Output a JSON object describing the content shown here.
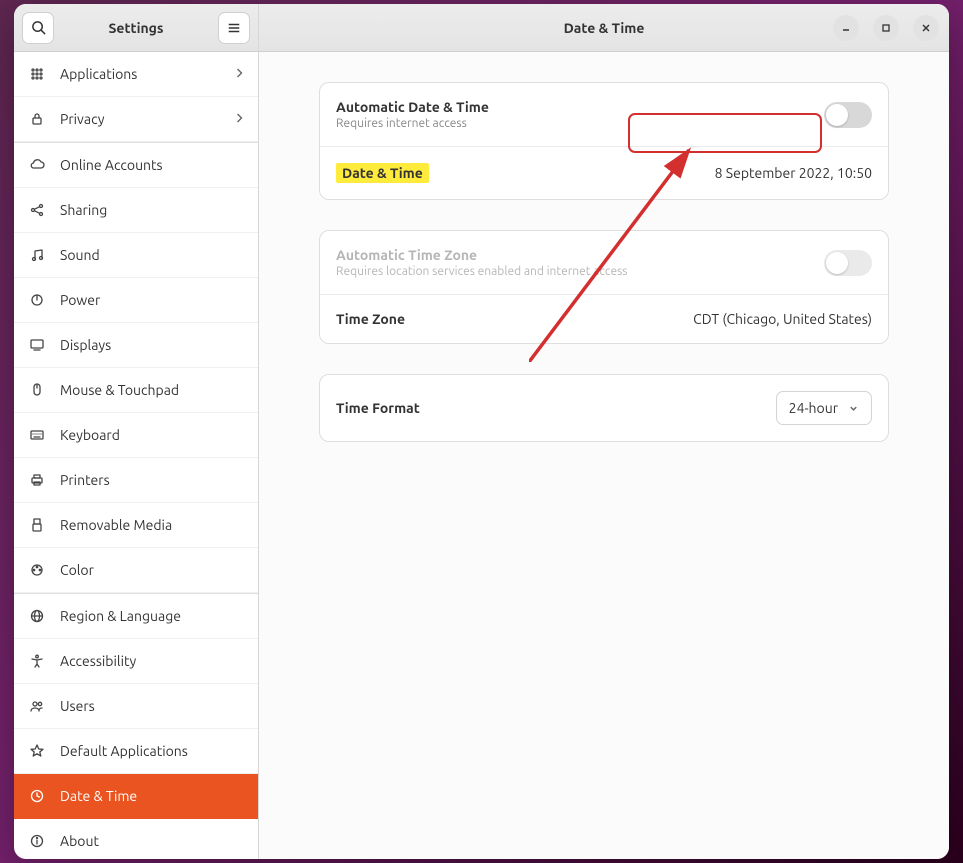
{
  "sidebar": {
    "title": "Settings",
    "items": [
      {
        "label": "Applications",
        "icon": "⠿",
        "chevron": true
      },
      {
        "label": "Privacy",
        "icon": "lock",
        "chevron": true
      },
      {
        "label": "Online Accounts",
        "icon": "cloud"
      },
      {
        "label": "Sharing",
        "icon": "share"
      },
      {
        "label": "Sound",
        "icon": "music"
      },
      {
        "label": "Power",
        "icon": "power"
      },
      {
        "label": "Displays",
        "icon": "display"
      },
      {
        "label": "Mouse & Touchpad",
        "icon": "mouse"
      },
      {
        "label": "Keyboard",
        "icon": "keyboard"
      },
      {
        "label": "Printers",
        "icon": "printer"
      },
      {
        "label": "Removable Media",
        "icon": "usb"
      },
      {
        "label": "Color",
        "icon": "color"
      },
      {
        "label": "Region & Language",
        "icon": "globe"
      },
      {
        "label": "Accessibility",
        "icon": "a11y"
      },
      {
        "label": "Users",
        "icon": "users"
      },
      {
        "label": "Default Applications",
        "icon": "star"
      },
      {
        "label": "Date & Time",
        "icon": "clock",
        "active": true
      },
      {
        "label": "About",
        "icon": "info"
      }
    ]
  },
  "header": {
    "title": "Date & Time"
  },
  "panel": {
    "auto_dt": {
      "label": "Automatic Date & Time",
      "sub": "Requires internet access",
      "on": false
    },
    "dt": {
      "label": "Date & Time",
      "value": "8 September 2022, 10:50"
    },
    "auto_tz": {
      "label": "Automatic Time Zone",
      "sub": "Requires location services enabled and internet access",
      "on": false,
      "disabled": true
    },
    "tz": {
      "label": "Time Zone",
      "value": "CDT (Chicago, United States)"
    },
    "fmt": {
      "label": "Time Format",
      "value": "24-hour"
    }
  }
}
